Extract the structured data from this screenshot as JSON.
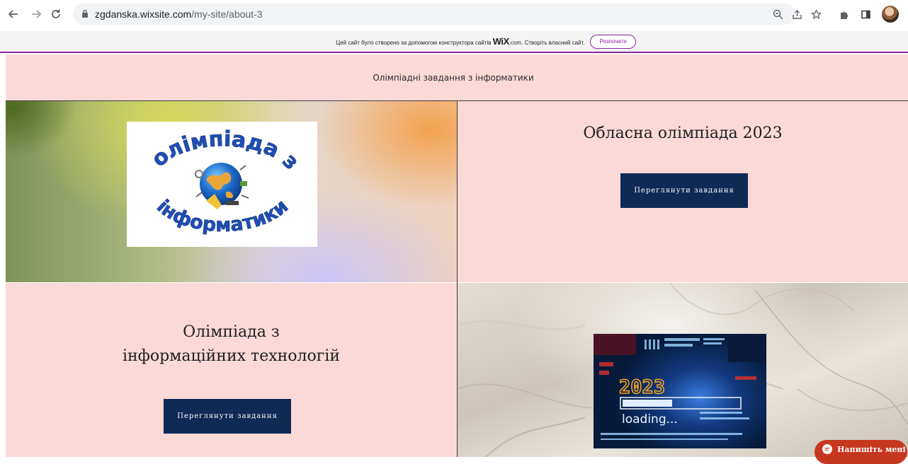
{
  "browser": {
    "url_host": "zgdanska.wixsite.com",
    "url_path": "/my-site/about-3",
    "icons": [
      "back-icon",
      "forward-icon",
      "reload-icon",
      "lock-icon",
      "zoom-icon",
      "share-icon",
      "star-icon",
      "extensions-icon",
      "sidebar-icon",
      "profile-avatar"
    ]
  },
  "wix_banner": {
    "text_before": "Цей сайт було створено за допомогою конструктора сайтів ",
    "brand": "WiX",
    "text_after": ".com. Створіть власний сайт.",
    "start_button": "Розпочати"
  },
  "site": {
    "title": "Олімпіадні завдання з інформатики",
    "logo": {
      "top_text": "олімпіада з",
      "bottom_text": "інформатики"
    },
    "oblast": {
      "heading": "Обласна олімпіада 2023",
      "button": "Переглянути завдання"
    },
    "it": {
      "heading_line1": "Олімпіада з",
      "heading_line2": "інформаційних технологій",
      "button": "Переглянути завдання"
    },
    "tech_image": {
      "year": "2023",
      "loading": "loading..."
    },
    "chat": {
      "label": "Напишіть мені"
    }
  },
  "colors": {
    "site_pink": "#fad9d7",
    "button_navy": "#0f2a55",
    "wix_purple": "#8a2a9b",
    "chat_red": "#c7361f"
  }
}
